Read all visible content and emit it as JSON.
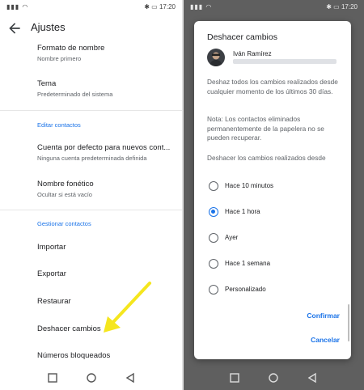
{
  "status_bar": {
    "time": "17:20"
  },
  "settings": {
    "title": "Ajustes",
    "items": [
      {
        "title": "Formato de nombre",
        "subtitle": "Nombre primero"
      },
      {
        "title": "Tema",
        "subtitle": "Predeterminado del sistema"
      }
    ],
    "section_edit": "Editar contactos",
    "edit_items": [
      {
        "title": "Cuenta por defecto para nuevos cont...",
        "subtitle": "Ninguna cuenta predeterminada definida"
      },
      {
        "title": "Nombre fonético",
        "subtitle": "Ocultar si está vacío"
      }
    ],
    "section_manage": "Gestionar contactos",
    "manage_items": [
      {
        "title": "Importar"
      },
      {
        "title": "Exportar"
      },
      {
        "title": "Restaurar"
      },
      {
        "title": "Deshacer cambios"
      },
      {
        "title": "Números bloqueados"
      }
    ]
  },
  "annotation": {
    "arrow_color": "#f5e61e"
  },
  "dialog": {
    "title": "Deshacer cambios",
    "account_name": "Iván Ramírez",
    "description": "Deshaz todos los cambios realizados desde cualquier momento de los últimos 30 días.",
    "note": "Nota: Los contactos eliminados permanentemente de la papelera no se pueden recuperar.",
    "prompt": "Deshacer los cambios realizados desde",
    "options": [
      {
        "label": "Hace 10 minutos",
        "selected": false
      },
      {
        "label": "Hace 1 hora",
        "selected": true
      },
      {
        "label": "Ayer",
        "selected": false
      },
      {
        "label": "Hace 1 semana",
        "selected": false
      },
      {
        "label": "Personalizado",
        "selected": false
      }
    ],
    "confirm_label": "Confirmar",
    "cancel_label": "Cancelar"
  },
  "colors": {
    "accent": "#1a73e8",
    "scrim": "#5f5f5f"
  },
  "icons": [
    "back-arrow-icon",
    "square-icon",
    "circle-icon",
    "triangle-back-icon",
    "signal-icon",
    "wifi-icon",
    "bluetooth-icon",
    "alarm-icon",
    "battery-icon"
  ]
}
